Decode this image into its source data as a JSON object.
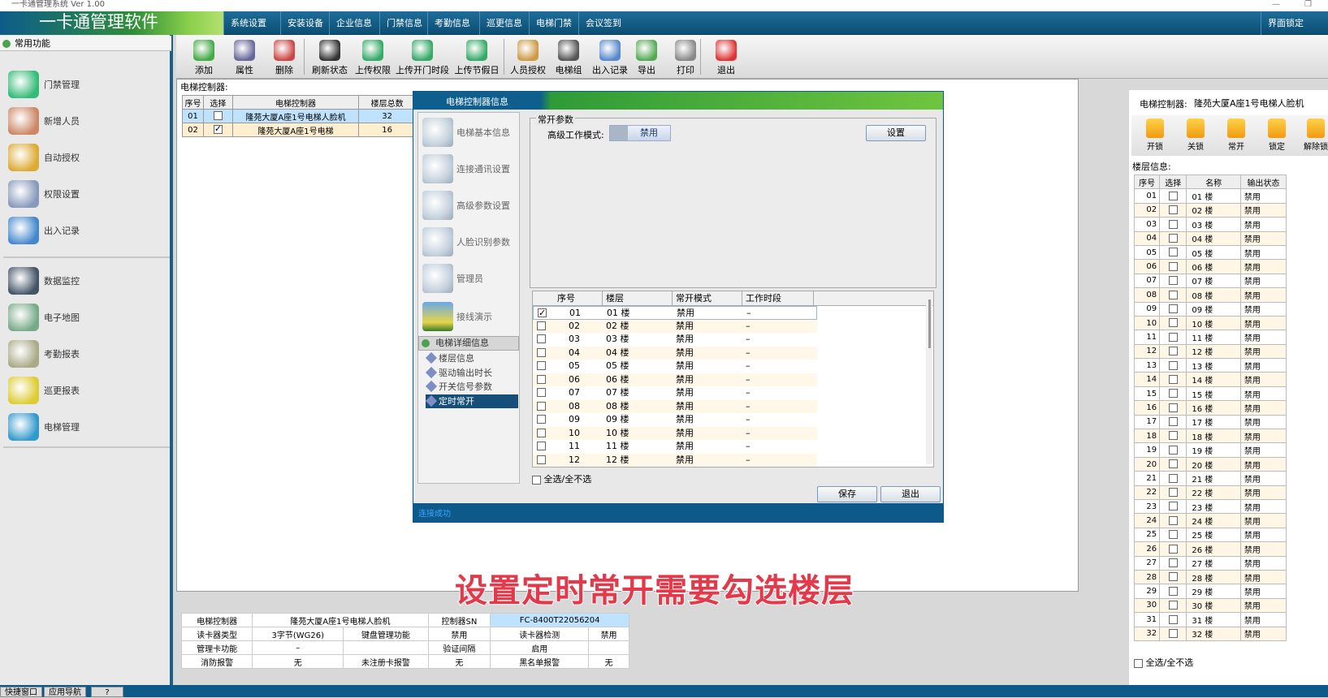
{
  "app": {
    "title": "一卡通管理系统  Ver 1.00",
    "brand": "一卡通管理软件"
  },
  "menu": [
    "系统设置",
    "安装设备",
    "企业信息",
    "门禁信息",
    "考勤信息",
    "巡更信息",
    "电梯门禁",
    "会议签到"
  ],
  "menu_right": "界面锁定",
  "leftpanel": {
    "header": "常用功能",
    "items": [
      "门禁管理",
      "新增人员",
      "自动授权",
      "权限设置",
      "出入记录",
      "数据监控",
      "电子地图",
      "考勤报表",
      "巡更报表",
      "电梯管理"
    ]
  },
  "toolbar": [
    "添加",
    "属性",
    "删除",
    "刷新状态",
    "上传权限",
    "上传开门时段",
    "上传节假日",
    "人员授权",
    "电梯组",
    "出入记录",
    "导出",
    "打印",
    "退出"
  ],
  "controller_label": "电梯控制器:",
  "controller_table": {
    "headers": [
      "序号",
      "选择",
      "电梯控制器",
      "楼层总数"
    ],
    "rows": [
      {
        "no": "01",
        "checked": false,
        "name": "隆苑大厦A座1号电梯人脸机",
        "floors": "32"
      },
      {
        "no": "02",
        "checked": true,
        "name": "隆苑大厦A座1号电梯",
        "floors": "16"
      }
    ]
  },
  "dialog": {
    "title": "电梯控制器信息",
    "nav": [
      "电梯基本信息",
      "连接通讯设置",
      "高级参数设置",
      "人脸识别参数",
      "管理员",
      "接线演示"
    ],
    "tree_head": "电梯详细信息",
    "tree": [
      "楼层信息",
      "驱动输出时长",
      "开关信号参数",
      "定时常开"
    ],
    "group_title": "常开参数",
    "mode_label": "高级工作模式:",
    "mode_value": "禁用",
    "set_button": "设置",
    "grid_headers": [
      "序号",
      "楼层",
      "常开模式",
      "工作时段"
    ],
    "grid_rows": [
      {
        "no": "01",
        "floor": "01 楼",
        "mode": "禁用",
        "period": "–",
        "checked": true
      },
      {
        "no": "02",
        "floor": "02 楼",
        "mode": "禁用",
        "period": "–",
        "checked": false
      },
      {
        "no": "03",
        "floor": "03 楼",
        "mode": "禁用",
        "period": "–",
        "checked": false
      },
      {
        "no": "04",
        "floor": "04 楼",
        "mode": "禁用",
        "period": "–",
        "checked": false
      },
      {
        "no": "05",
        "floor": "05 楼",
        "mode": "禁用",
        "period": "–",
        "checked": false
      },
      {
        "no": "06",
        "floor": "06 楼",
        "mode": "禁用",
        "period": "–",
        "checked": false
      },
      {
        "no": "07",
        "floor": "07 楼",
        "mode": "禁用",
        "period": "–",
        "checked": false
      },
      {
        "no": "08",
        "floor": "08 楼",
        "mode": "禁用",
        "period": "–",
        "checked": false
      },
      {
        "no": "09",
        "floor": "09 楼",
        "mode": "禁用",
        "period": "–",
        "checked": false
      },
      {
        "no": "10",
        "floor": "10 楼",
        "mode": "禁用",
        "period": "–",
        "checked": false
      },
      {
        "no": "11",
        "floor": "11 楼",
        "mode": "禁用",
        "period": "–",
        "checked": false
      },
      {
        "no": "12",
        "floor": "12 楼",
        "mode": "禁用",
        "period": "–",
        "checked": false
      }
    ],
    "select_all": "全选/全不选",
    "save": "保存",
    "exit": "退出",
    "status": "连接成功"
  },
  "right": {
    "controller_label": "电梯控制器:",
    "controller_value": "隆苑大厦A座1号电梯人脸机",
    "locks": [
      "开锁",
      "关锁",
      "常开",
      "锁定",
      "解除锁"
    ],
    "floor_info_label": "楼层信息:",
    "headers": [
      "序号",
      "选择",
      "名称",
      "输出状态"
    ],
    "rows": [
      "01",
      "02",
      "03",
      "04",
      "05",
      "06",
      "07",
      "08",
      "09",
      "10",
      "11",
      "12",
      "13",
      "14",
      "15",
      "16",
      "17",
      "18",
      "19",
      "20",
      "21",
      "22",
      "23",
      "24",
      "25",
      "26",
      "27",
      "28",
      "29",
      "30",
      "31",
      "32"
    ],
    "status": "禁用",
    "floor_suffix": "楼",
    "select_all": "全选/全不选"
  },
  "bottom_table": [
    [
      "电梯控制器",
      "隆苑大厦A座1号电梯人脸机",
      "控制器SN",
      "FC-8400T22056204"
    ],
    [
      "读卡器类型",
      "3字节(WG26)",
      "键盘管理功能",
      "禁用",
      "读卡器检测",
      "禁用"
    ],
    [
      "管理卡功能",
      "–",
      "",
      "验证间隔",
      "启用"
    ],
    [
      "消防报警",
      "无",
      "未注册卡报警",
      "无",
      "黑名单报警",
      "无"
    ]
  ],
  "subtitle": "设置定时常开需要勾选楼层",
  "bottom_tabs": [
    "快捷窗口",
    "应用导航",
    "?"
  ]
}
